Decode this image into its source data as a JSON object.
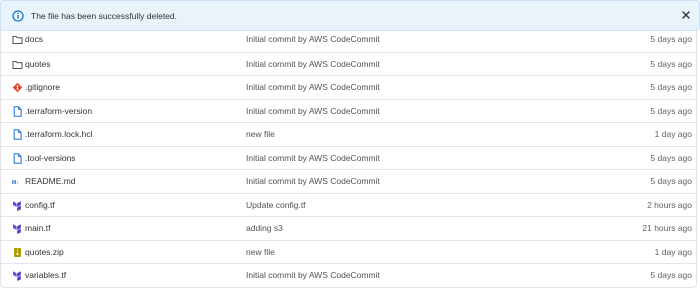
{
  "alert": {
    "message": "The file has been successfully deleted.",
    "info_icon": "info-circle-icon",
    "close_icon": "close-icon"
  },
  "colors": {
    "info": "#1f75cb",
    "folder": "#535158",
    "git": "#e24329",
    "doc": "#1f75cb",
    "terraform": "#4a3dba",
    "markdown": "#1f75cb",
    "zip": "#a89a00"
  },
  "files": [
    {
      "name": "docs",
      "icon": "folder-icon",
      "commit": "Initial commit by AWS CodeCommit",
      "date": "5 days ago"
    },
    {
      "name": "quotes",
      "icon": "folder-icon",
      "commit": "Initial commit by AWS CodeCommit",
      "date": "5 days ago"
    },
    {
      "name": ".gitignore",
      "icon": "git-icon",
      "commit": "Initial commit by AWS CodeCommit",
      "date": "5 days ago"
    },
    {
      "name": ".terraform-version",
      "icon": "file-icon",
      "commit": "Initial commit by AWS CodeCommit",
      "date": "5 days ago"
    },
    {
      "name": ".terraform.lock.hcl",
      "icon": "file-icon",
      "commit": "new file",
      "date": "1 day ago"
    },
    {
      "name": ".tool-versions",
      "icon": "file-icon",
      "commit": "Initial commit by AWS CodeCommit",
      "date": "5 days ago"
    },
    {
      "name": "README.md",
      "icon": "markdown-icon",
      "commit": "Initial commit by AWS CodeCommit",
      "date": "5 days ago"
    },
    {
      "name": "config.tf",
      "icon": "terraform-icon",
      "commit": "Update config.tf",
      "date": "2 hours ago"
    },
    {
      "name": "main.tf",
      "icon": "terraform-icon",
      "commit": "adding s3",
      "date": "21 hours ago"
    },
    {
      "name": "quotes.zip",
      "icon": "zip-icon",
      "commit": "new file",
      "date": "1 day ago"
    },
    {
      "name": "variables.tf",
      "icon": "terraform-icon",
      "commit": "Initial commit by AWS CodeCommit",
      "date": "5 days ago"
    }
  ]
}
